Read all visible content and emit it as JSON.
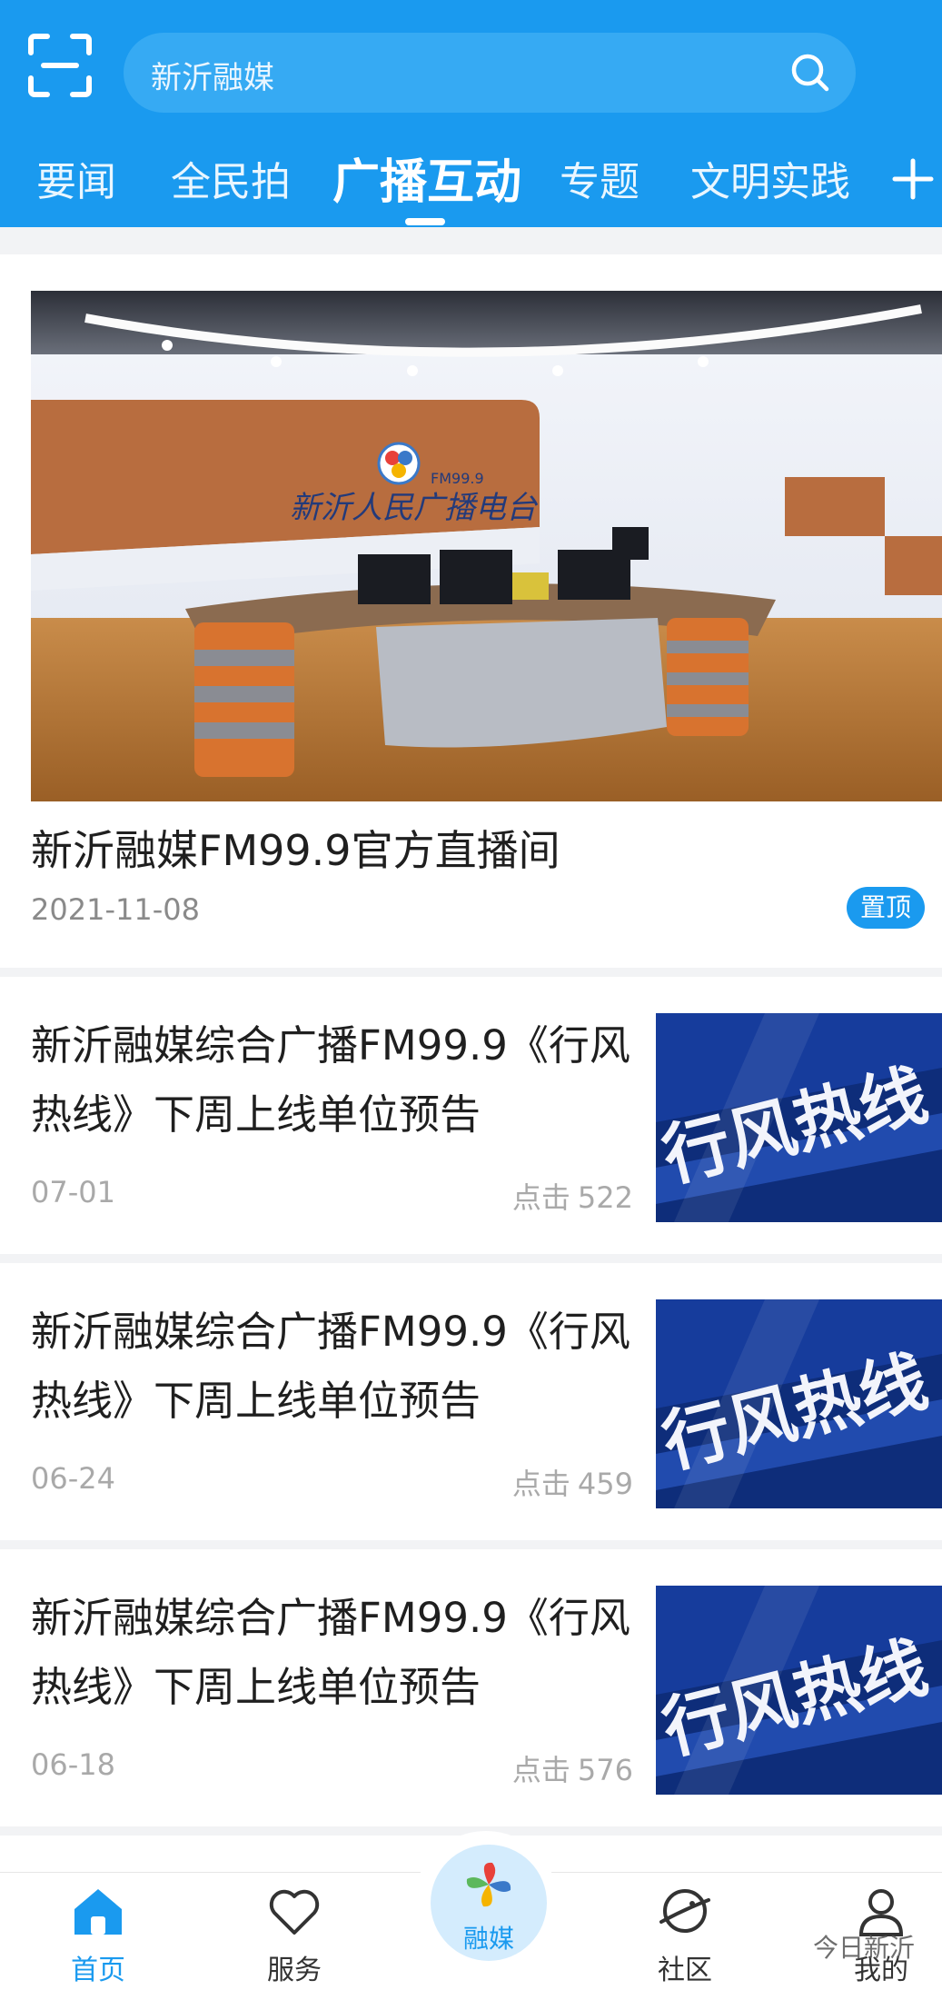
{
  "header": {
    "search_placeholder": "新沂融媒",
    "tabs": [
      {
        "label": "要闻"
      },
      {
        "label": "全民拍"
      },
      {
        "label": "广播互动"
      },
      {
        "label": "专题"
      },
      {
        "label": "文明实践"
      }
    ],
    "active_tab": "广播互动"
  },
  "featured": {
    "title": "新沂融媒FM99.9官方直播间",
    "date": "2021-11-08",
    "badge": "置顶",
    "image_sign": "新沂人民广播电台",
    "image_logo_text": "FM99.9"
  },
  "news": [
    {
      "title": "新沂融媒综合广播FM99.9《行风热线》下周上线单位预告",
      "date": "07-01",
      "clicks_label": "点击",
      "clicks": "522",
      "thumb_text": "行风热线"
    },
    {
      "title": "新沂融媒综合广播FM99.9《行风热线》下周上线单位预告",
      "date": "06-24",
      "clicks_label": "点击",
      "clicks": "459",
      "thumb_text": "行风热线"
    },
    {
      "title": "新沂融媒综合广播FM99.9《行风热线》下周上线单位预告",
      "date": "06-18",
      "clicks_label": "点击",
      "clicks": "576",
      "thumb_text": "行风热线"
    }
  ],
  "bottom_nav": [
    {
      "label": "首页",
      "icon": "home-icon",
      "active": true
    },
    {
      "label": "服务",
      "icon": "heart-icon",
      "active": false
    },
    {
      "label": "融媒",
      "icon": "pinwheel-logo-icon",
      "active": false
    },
    {
      "label": "社区",
      "icon": "planet-icon",
      "active": false
    },
    {
      "label": "我的",
      "icon": "user-icon",
      "active": false
    }
  ],
  "watermark": "今日新沂",
  "colors": {
    "brand": "#1a9aef",
    "badge": "#1a9aef",
    "text_muted": "#a9a9a9"
  }
}
